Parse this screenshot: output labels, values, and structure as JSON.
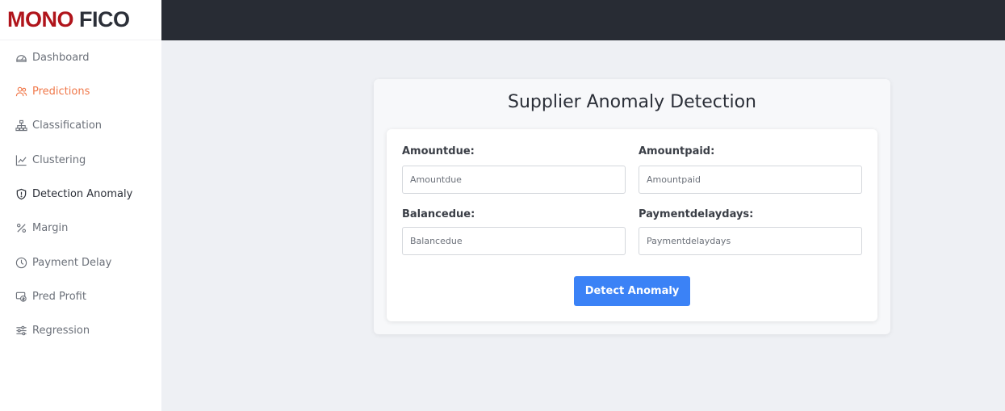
{
  "brand": {
    "part1": "MONO",
    "part2": "FICO"
  },
  "sidebar": {
    "items": [
      {
        "label": "Dashboard",
        "icon": "dashboard-gauge-icon"
      },
      {
        "label": "Predictions",
        "icon": "users-icon"
      },
      {
        "label": "Classification",
        "icon": "sitemap-icon"
      },
      {
        "label": "Clustering",
        "icon": "line-chart-icon"
      },
      {
        "label": "Detection Anomaly",
        "icon": "shield-icon"
      },
      {
        "label": "Margin",
        "icon": "percent-icon"
      },
      {
        "label": "Payment Delay",
        "icon": "clock-icon"
      },
      {
        "label": "Pred Profit",
        "icon": "money-icon"
      },
      {
        "label": "Regression",
        "icon": "sliders-icon"
      }
    ]
  },
  "form": {
    "title": "Supplier Anomaly Detection",
    "fields": [
      {
        "label": "Amountdue:",
        "placeholder": "Amountdue",
        "value": ""
      },
      {
        "label": "Amountpaid:",
        "placeholder": "Amountpaid",
        "value": ""
      },
      {
        "label": "Balancedue:",
        "placeholder": "Balancedue",
        "value": ""
      },
      {
        "label": "Paymentdelaydays:",
        "placeholder": "Paymentdelaydays",
        "value": ""
      }
    ],
    "submit_label": "Detect Anomaly"
  },
  "colors": {
    "brand_red": "#b0141b",
    "active_nav": "#f0784a",
    "topbar": "#282c34",
    "button": "#3b82f6"
  }
}
